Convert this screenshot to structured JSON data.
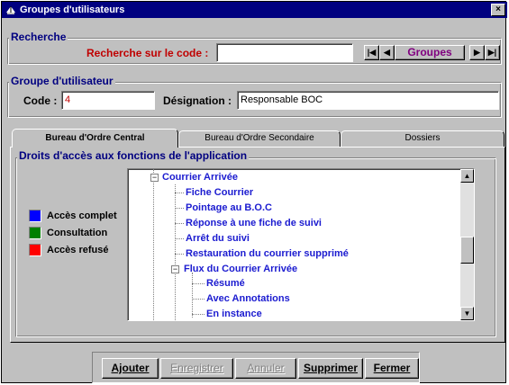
{
  "window": {
    "title": "Groupes d'utilisateurs",
    "close_glyph": "×"
  },
  "recherche": {
    "group_label": "Recherche",
    "label": "Recherche sur le code :",
    "value": "",
    "nav": {
      "first": "|◀",
      "prev": "◀",
      "current": "Groupes",
      "next": "▶",
      "last": "▶|"
    }
  },
  "groupe": {
    "group_label": "Groupe d'utilisateur",
    "code_label": "Code :",
    "code_value": "4",
    "designation_label": "Désignation :",
    "designation_value": "Responsable BOC"
  },
  "tabs": [
    {
      "label": "Bureau d'Ordre Central",
      "active": true
    },
    {
      "label": "Bureau d'Ordre Secondaire",
      "active": false
    },
    {
      "label": "Dossiers",
      "active": false
    }
  ],
  "droits": {
    "group_label": "Droits d'accès aux fonctions de l'application",
    "legend": [
      {
        "label": "Accès complet",
        "color": "#0000ff"
      },
      {
        "label": "Consultation",
        "color": "#008000"
      },
      {
        "label": "Accès refusé",
        "color": "#ff0000"
      }
    ],
    "tree": [
      {
        "label": "Courrier Arrivée",
        "level": 1,
        "expandable": true
      },
      {
        "label": "Fiche Courrier",
        "level": 2
      },
      {
        "label": "Pointage au B.O.C",
        "level": 2
      },
      {
        "label": "Réponse à une fiche de suivi",
        "level": 2
      },
      {
        "label": "Arrêt du suivi",
        "level": 2
      },
      {
        "label": "Restauration du courrier supprimé",
        "level": 2
      },
      {
        "label": "Flux du Courrier Arrivée",
        "level": 2,
        "expandable": true
      },
      {
        "label": "Résumé",
        "level": 3
      },
      {
        "label": "Avec Annotations",
        "level": 3
      },
      {
        "label": "En instance",
        "level": 3
      }
    ],
    "scroll_up": "▲",
    "scroll_down": "▼",
    "expand_glyph": "−"
  },
  "buttons": {
    "ajouter": "Ajouter",
    "enregistrer": "Enregistrer",
    "annuler": "Annuler",
    "supprimer": "Supprimer",
    "fermer": "Fermer"
  },
  "colors": {
    "title_bar": "#000080",
    "group_label": "#000080",
    "tree_text": "#1b1bd0",
    "recherche_label": "#c00000",
    "nav_current": "#800080"
  }
}
